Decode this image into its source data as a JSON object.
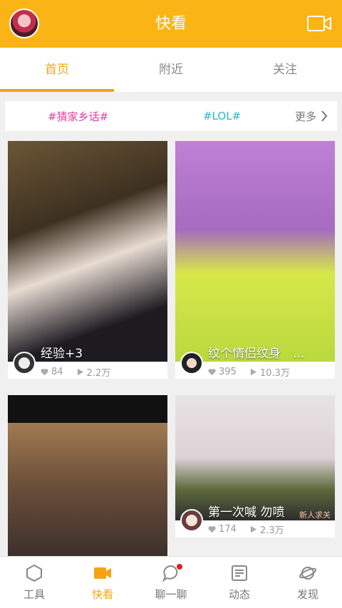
{
  "header": {
    "title": "快看"
  },
  "tabs": [
    {
      "label": "首页",
      "active": true
    },
    {
      "label": "附近",
      "active": false
    },
    {
      "label": "关注",
      "active": false
    }
  ],
  "topics": {
    "topic1": "#猜家乡话#",
    "topic2": "#LOL#",
    "more": "更多"
  },
  "cards": [
    {
      "caption": "经验+3",
      "likes": "84",
      "plays": "2.2万"
    },
    {
      "caption": "纹个情侣纹身　...",
      "likes": "395",
      "plays": "10.3万"
    },
    {
      "caption": "",
      "likes": "",
      "plays": ""
    },
    {
      "caption": "第一次喊 勿喷",
      "likes": "174",
      "plays": "2.3万",
      "badge": "新人求关"
    }
  ],
  "nav": [
    {
      "label": "工具",
      "icon": "hexagon-icon",
      "active": false
    },
    {
      "label": "快看",
      "icon": "video-camera-icon",
      "active": true
    },
    {
      "label": "聊一聊",
      "icon": "chat-bubble-icon",
      "active": false,
      "has_dot": true
    },
    {
      "label": "动态",
      "icon": "feed-icon",
      "active": false
    },
    {
      "label": "发现",
      "icon": "planet-icon",
      "active": false
    }
  ],
  "colors": {
    "accent": "#fbb416",
    "active_tab": "#f5a313",
    "topic_pink": "#e63ba1",
    "topic_teal": "#2cb7c8",
    "notify_dot": "#e02020"
  }
}
